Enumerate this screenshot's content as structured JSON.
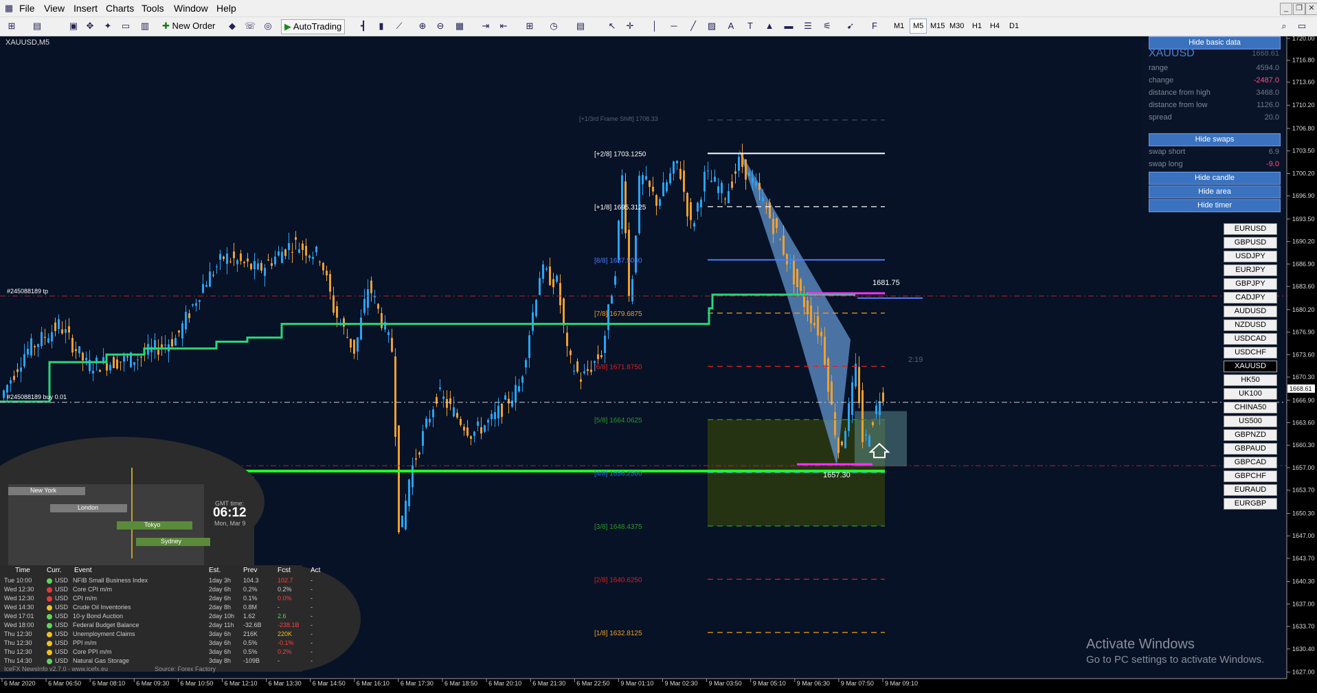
{
  "menubar": {
    "items": [
      "File",
      "View",
      "Insert",
      "Charts",
      "Tools",
      "Window",
      "Help"
    ]
  },
  "toolbar": {
    "new_order": "New Order",
    "autotrading": "AutoTrading",
    "timeframes": [
      "M1",
      "M5",
      "M15",
      "M30",
      "H1",
      "H4",
      "D1"
    ],
    "active_timeframe": "M5"
  },
  "chart": {
    "symbol_label": "XAUUSD,M5",
    "bid_price_label": "1668.61",
    "order_labels": {
      "tp": "#245088189 tp",
      "buy": "#245088189 buy 0.01"
    },
    "murrey_levels": [
      {
        "label": "[+1/3rd Frame Shift]",
        "value": "1708.33",
        "color": "#5a6270"
      },
      {
        "label": "[+2/8]",
        "value": "1703.1250",
        "color": "#ffffff"
      },
      {
        "label": "[+1/8]",
        "value": "1695.3125",
        "color": "#ffffff"
      },
      {
        "label": "[8/8]",
        "value": "1687.5000",
        "color": "#4d7cff"
      },
      {
        "label": "[7/8]",
        "value": "1679.6875",
        "color": "#f0a020"
      },
      {
        "label": "[6/8]",
        "value": "1671.8750",
        "color": "#e02020"
      },
      {
        "label": "[5/8]",
        "value": "1664.0625",
        "color": "#2a9a2a"
      },
      {
        "label": "[4/8]",
        "value": "1656.2500",
        "color": "#2e6bff"
      },
      {
        "label": "[3/8]",
        "value": "1648.4375",
        "color": "#2a9a2a"
      },
      {
        "label": "[2/8]",
        "value": "1640.6250",
        "color": "#e02020"
      },
      {
        "label": "[1/8]",
        "value": "1632.8125",
        "color": "#f0a020"
      }
    ],
    "annotations": {
      "high_label": "1681.75",
      "low_label": "1657.30",
      "timer": "2:19"
    },
    "price_axis": [
      "1720.00",
      "1716.80",
      "1713.60",
      "1710.20",
      "1706.80",
      "1703.50",
      "1700.20",
      "1696.90",
      "1693.50",
      "1690.20",
      "1686.90",
      "1683.60",
      "1680.20",
      "1676.90",
      "1673.60",
      "1670.30",
      "1666.90",
      "1663.60",
      "1660.30",
      "1657.00",
      "1653.70",
      "1650.30",
      "1647.00",
      "1643.70",
      "1640.30",
      "1637.00",
      "1633.70",
      "1630.40",
      "1627.00"
    ],
    "time_axis": [
      "6 Mar 2020",
      "6 Mar 06:50",
      "6 Mar 08:10",
      "6 Mar 09:30",
      "6 Mar 10:50",
      "6 Mar 12:10",
      "6 Mar 13:30",
      "6 Mar 14:50",
      "6 Mar 16:10",
      "6 Mar 17:30",
      "6 Mar 18:50",
      "6 Mar 20:10",
      "6 Mar 21:30",
      "6 Mar 22:50",
      "9 Mar 01:10",
      "9 Mar 02:30",
      "9 Mar 03:50",
      "9 Mar 05:10",
      "9 Mar 06:30",
      "9 Mar 07:50",
      "9 Mar 09:10"
    ]
  },
  "basic_panel": {
    "hide_basic_btn": "Hide basic data",
    "symbol": "XAUUSD",
    "symbol_price": "1668.61",
    "rows": [
      {
        "k": "range",
        "v": "4594.0",
        "color": "#6f7a8c"
      },
      {
        "k": "change",
        "v": "-2487.0",
        "color": "#ff4f86"
      },
      {
        "k": "distance from high",
        "v": "3468.0",
        "color": "#6f7a8c"
      },
      {
        "k": "distance from low",
        "v": "1126.0",
        "color": "#6f7a8c"
      },
      {
        "k": "spread",
        "v": "20.0",
        "color": "#6f7a8c"
      }
    ],
    "hide_swaps_btn": "Hide swaps",
    "swaps": [
      {
        "k": "swap short",
        "v": "6.9",
        "color": "#6f7a8c"
      },
      {
        "k": "swap long",
        "v": "-9.0",
        "color": "#ff4f86"
      }
    ],
    "hide_candle_btn": "Hide candle",
    "hide_area_btn": "Hide area",
    "hide_timer_btn": "Hide timer"
  },
  "symbol_buttons": [
    "EURUSD",
    "GBPUSD",
    "USDJPY",
    "EURJPY",
    "GBPJPY",
    "CADJPY",
    "AUDUSD",
    "NZDUSD",
    "USDCAD",
    "USDCHF",
    "XAUUSD",
    "HK50",
    "UK100",
    "CHINA50",
    "US500",
    "GBPNZD",
    "GBPAUD",
    "GBPCAD",
    "GBPCHF",
    "EURAUD",
    "EURGBP"
  ],
  "selected_symbol": "XAUUSD",
  "world_clock": {
    "gmt_label": "GMT time:",
    "time": "06:12",
    "date": "Mon, Mar 9",
    "sessions": [
      "New York",
      "London",
      "Tokyo",
      "Sydney"
    ]
  },
  "news": {
    "headers": [
      "Time",
      "Curr.",
      "Event",
      "Est.",
      "Prev",
      "Fcst",
      "Act"
    ],
    "rows": [
      {
        "time": "Tue  10:00",
        "dot": "#5fd35f",
        "curr": "USD",
        "event": "NFIB Small Business Index",
        "est": "1day 3h",
        "prev": "104.3",
        "fcst": "102.7",
        "fcst_color": "#ff4040",
        "act": "-"
      },
      {
        "time": "Wed  12:30",
        "dot": "#e23b3b",
        "curr": "USD",
        "event": "Core CPI m/m",
        "est": "2day 6h",
        "prev": "0.2%",
        "fcst": "0.2%",
        "fcst_color": "#cccccc",
        "act": "-"
      },
      {
        "time": "Wed  12:30",
        "dot": "#e23b3b",
        "curr": "USD",
        "event": "CPI m/m",
        "est": "2day 6h",
        "prev": "0.1%",
        "fcst": "0.0%",
        "fcst_color": "#ff4040",
        "act": "-"
      },
      {
        "time": "Wed  14:30",
        "dot": "#f0c020",
        "curr": "USD",
        "event": "Crude Oil Inventories",
        "est": "2day 8h",
        "prev": "0.8M",
        "fcst": "-",
        "fcst_color": "#cccccc",
        "act": "-"
      },
      {
        "time": "Wed  17:01",
        "dot": "#5fd35f",
        "curr": "USD",
        "event": "10-y Bond Auction",
        "est": "2day 10h",
        "prev": "1.62",
        "fcst": "2.6",
        "fcst_color": "#5fd35f",
        "act": "-"
      },
      {
        "time": "Wed  18:00",
        "dot": "#5fd35f",
        "curr": "USD",
        "event": "Federal Budget Balance",
        "est": "2day 11h",
        "prev": "-32.6B",
        "fcst": "-238.1B",
        "fcst_color": "#ff4040",
        "act": "-"
      },
      {
        "time": "Thu  12:30",
        "dot": "#f0c020",
        "curr": "USD",
        "event": "Unemployment Claims",
        "est": "3day 6h",
        "prev": "216K",
        "fcst": "220K",
        "fcst_color": "#f0c020",
        "act": "-"
      },
      {
        "time": "Thu  12:30",
        "dot": "#f0c020",
        "curr": "USD",
        "event": "PPI m/m",
        "est": "3day 6h",
        "prev": "0.5%",
        "fcst": "-0.1%",
        "fcst_color": "#ff4040",
        "act": "-"
      },
      {
        "time": "Thu  12:30",
        "dot": "#f0c020",
        "curr": "USD",
        "event": "Core PPI m/m",
        "est": "3day 6h",
        "prev": "0.5%",
        "fcst": "0.2%",
        "fcst_color": "#ff4040",
        "act": "-"
      },
      {
        "time": "Thu  14:30",
        "dot": "#5fd35f",
        "curr": "USD",
        "event": "Natural Gas Storage",
        "est": "3day 8h",
        "prev": "-109B",
        "fcst": "-",
        "fcst_color": "#cccccc",
        "act": "-"
      }
    ],
    "footer_left": "IceFX NewsInfo v2.7.0  -  www.icefx.eu",
    "footer_right": "Source: Forex Factory"
  },
  "watermark": {
    "title": "Activate Windows",
    "sub": "Go to PC settings to activate Windows."
  }
}
